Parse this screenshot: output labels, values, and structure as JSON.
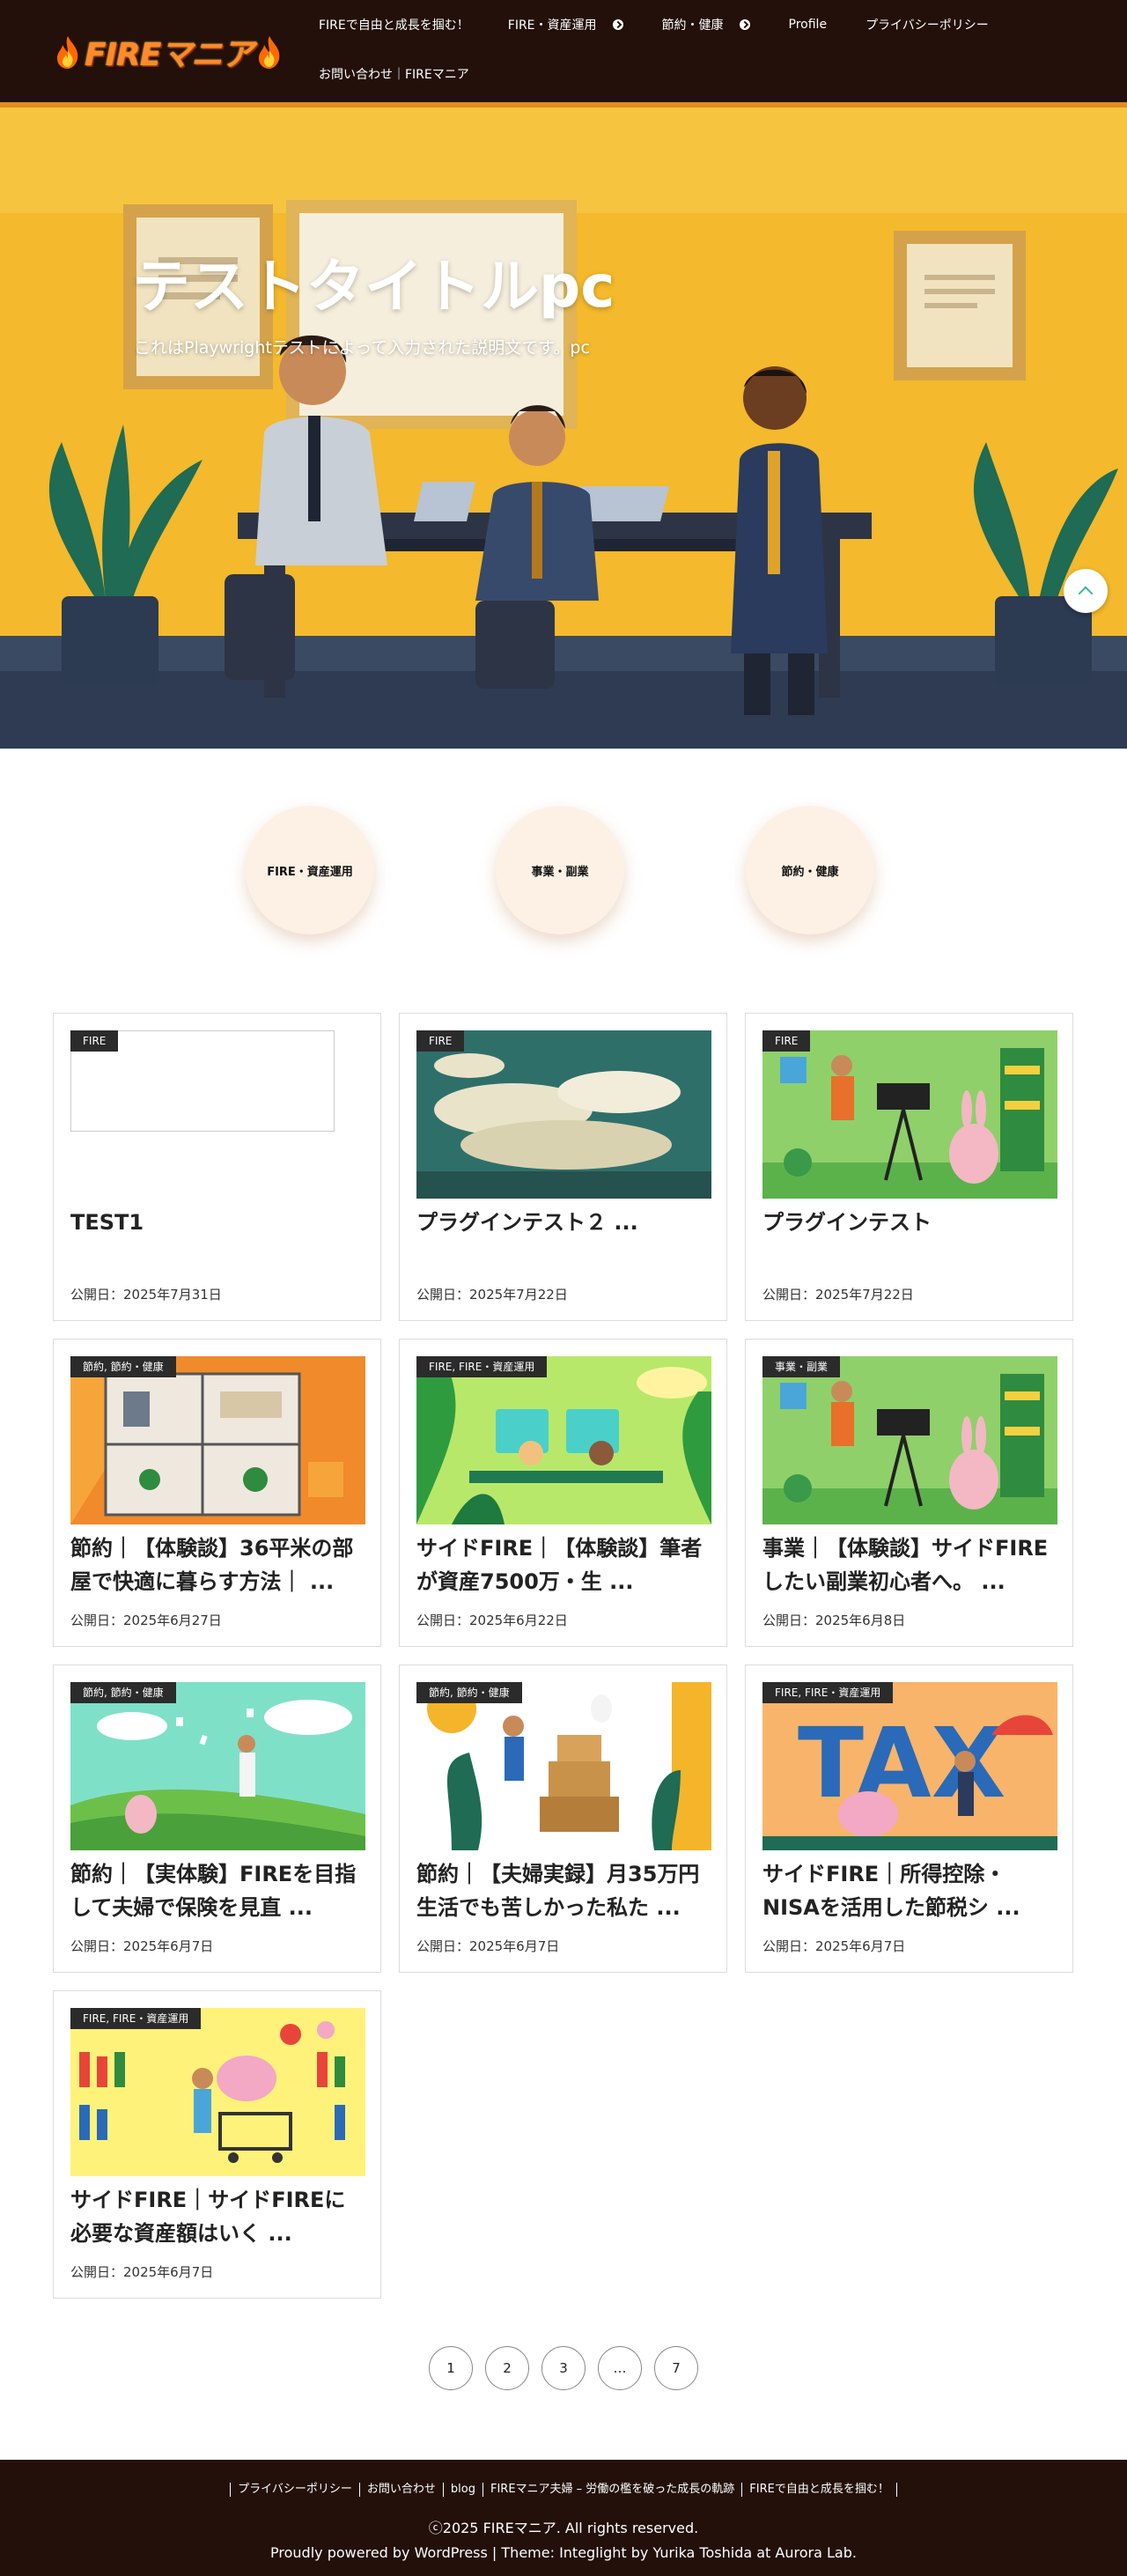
{
  "header": {
    "logo_text": "FIREマニア",
    "nav": [
      {
        "label": "FIREで自由と成長を掴む！",
        "has_children": false
      },
      {
        "label": "FIRE・資産運用",
        "has_children": true
      },
      {
        "label": "節約・健康",
        "has_children": true
      },
      {
        "label": "Profile",
        "has_children": false
      },
      {
        "label": "プライバシーポリシー",
        "has_children": false
      },
      {
        "label": "お問い合わせ｜FIREマニア",
        "has_children": false
      }
    ]
  },
  "hero": {
    "title": "テストタイトルpc",
    "description": "これはPlaywrightテストによって入力された説明文です。pc"
  },
  "categories": [
    "FIRE・資産運用",
    "事業・副業",
    "節約・健康"
  ],
  "posts": [
    {
      "badge": "FIRE",
      "title": "TEST1",
      "date": "公開日：2025年7月31日",
      "thumb": "empty"
    },
    {
      "badge": "FIRE",
      "title": "プラグインテスト２ ...",
      "date": "公開日：2025年7月22日",
      "thumb": "clouds"
    },
    {
      "badge": "FIRE",
      "title": "プラグインテスト",
      "date": "公開日：2025年7月22日",
      "thumb": "camera"
    },
    {
      "badge": "節約, 節約・健康",
      "title": "節約｜【体験談】36平米の部屋で快適に暮らす方法｜ ...",
      "date": "公開日：2025年6月27日",
      "thumb": "floorplan"
    },
    {
      "badge": "FIRE, FIRE・資産運用",
      "title": "サイドFIRE｜【体験談】筆者が資産7500万・生 ...",
      "date": "公開日：2025年6月22日",
      "thumb": "desk"
    },
    {
      "badge": "事業・副業",
      "title": "事業｜【体験談】サイドFIREしたい副業初心者へ。 ...",
      "date": "公開日：2025年6月8日",
      "thumb": "camera"
    },
    {
      "badge": "節約, 節約・健康",
      "title": "節約｜【実体験】FIREを目指して夫婦で保険を見直 ...",
      "date": "公開日：2025年6月7日",
      "thumb": "papers"
    },
    {
      "badge": "節約, 節約・健康",
      "title": "節約｜【夫婦実録】月35万円生活でも苦しかった私た ...",
      "date": "公開日：2025年6月7日",
      "thumb": "boxes"
    },
    {
      "badge": "FIRE, FIRE・資産運用",
      "title": "サイドFIRE｜所得控除・NISAを活用した節税シ ...",
      "date": "公開日：2025年6月7日",
      "thumb": "tax"
    },
    {
      "badge": "FIRE, FIRE・資産運用",
      "title": "サイドFIRE｜サイドFIREに必要な資産額はいく ...",
      "date": "公開日：2025年6月7日",
      "thumb": "shop"
    }
  ],
  "pagination": [
    "1",
    "2",
    "3",
    "…",
    "7"
  ],
  "tax_letters": "TAX",
  "footer": {
    "links": [
      "プライバシーポリシー",
      "お問い合わせ",
      "blog",
      "FIREマニア夫婦 – 労働の檻を破った成長の軌跡",
      "FIREで自由と成長を掴む！"
    ],
    "copyright": "ⓒ2025 FIREマニア. All rights reserved.",
    "powered": "Proudly powered by WordPress | Theme: Integlight by Yurika Toshida at Aurora Lab."
  },
  "colors": {
    "header_bg": "#23100a",
    "accent": "#e08a1e",
    "badge_bg": "#2b2b2b",
    "cat_bg": "#fcf1e4"
  }
}
